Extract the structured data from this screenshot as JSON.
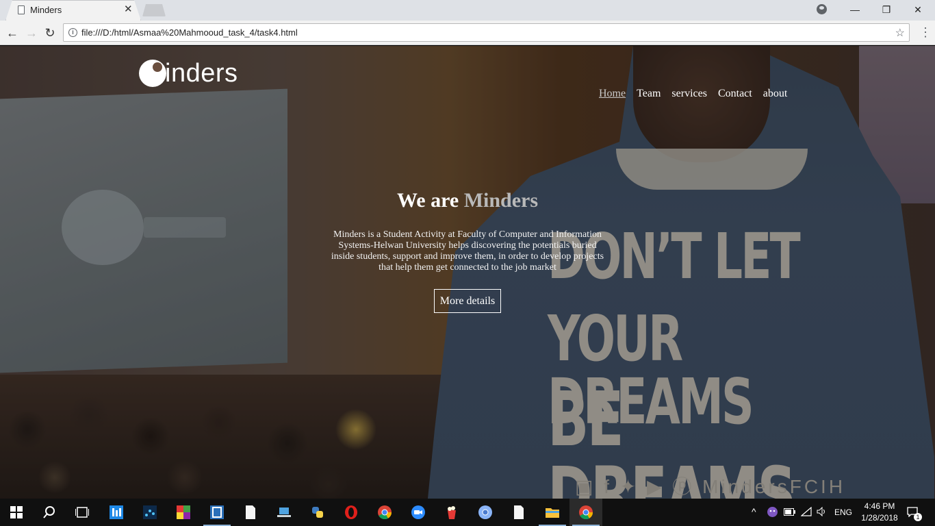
{
  "browser": {
    "tab_title": "Minders",
    "tab_close": "✕",
    "url": "file:///D:/html/Asmaa%20Mahmooud_task_4/task4.html",
    "back": "←",
    "forward": "→",
    "reload": "↻",
    "star": "☆",
    "menu": "⋮",
    "minimize": "—",
    "restore": "❐",
    "close": "✕"
  },
  "site": {
    "logo_text": "inders",
    "nav": [
      {
        "label": "Home",
        "active": true
      },
      {
        "label": "Team"
      },
      {
        "label": "services"
      },
      {
        "label": "Contact"
      },
      {
        "label": "about"
      }
    ],
    "hero": {
      "title_prefix": "We are",
      "title_accent": "Minders",
      "description": "Minders is a Student Activity at Faculty of Computer and Information Systems-Helwan University helps discovering the potentials buried inside students, support and improve them, in order to develop projects that help them get connected to the job market",
      "button_label": "More details"
    },
    "shirt": {
      "line1": "DON’T LET",
      "line2": "YOUR DREAMS",
      "line3": "BE DREAMS",
      "handle": "MindersFCIH"
    }
  },
  "taskbar": {
    "language": "ENG",
    "time": "4:46 PM",
    "date": "1/28/2018",
    "notifications": "1",
    "apps": [
      "start-icon",
      "search-icon",
      "task-view-icon",
      "files-app-icon",
      "network-app-icon",
      "color-squares-app-icon",
      "brackets-editor-icon",
      "text-file-icon",
      "laptop-app-icon",
      "python-icon",
      "opera-icon",
      "chrome-icon",
      "zoom-icon",
      "popcorn-icon",
      "chromium-icon",
      "document-icon",
      "file-explorer-icon",
      "chrome-active-icon"
    ]
  }
}
